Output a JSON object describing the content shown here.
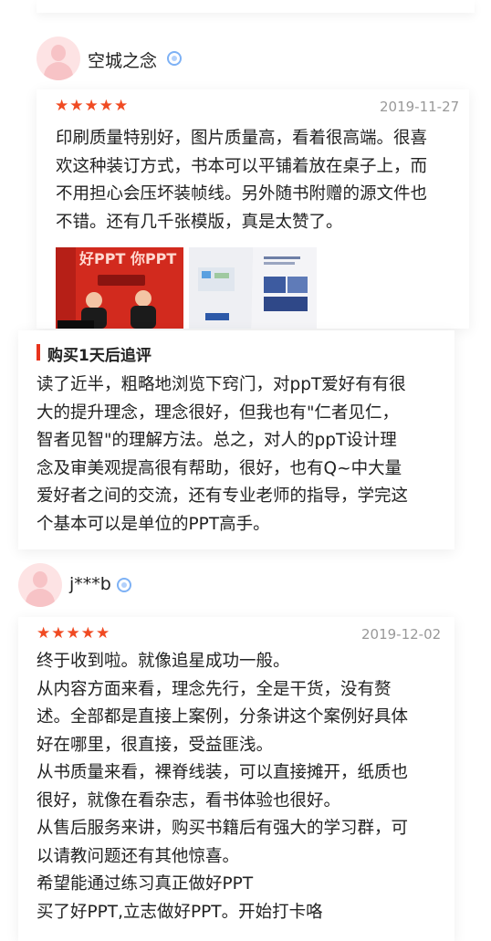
{
  "reviews": [
    {
      "username": "空城之念",
      "rating_text": "★★★★★",
      "rating": 5,
      "date": "2019-11-27",
      "content": [
        "印刷质量特别好，图片质量高，看着很高端。很喜",
        "欢这种装订方式，书本可以平铺着放在桌子上，而",
        "不用担心会压坏装帧线。另外随书附赠的源文件也",
        "不错。还有几千张模版，真是太赞了。"
      ],
      "photos": [
        {
          "label": "book-cover-photo",
          "cover_text": "好PPT 你PPT"
        },
        {
          "label": "book-inner-page-photo"
        }
      ],
      "followup": {
        "title": "购买1天后追评",
        "content": [
          "读了近半，粗略地浏览下窍门，对ppT爱好有有很",
          "大的提升理念，理念很好，但我也有\"仁者见仁，",
          "智者见智\"的理解方法。总之，对人的ppT设计理",
          "念及审美观提高很有帮助，很好，也有Q~中大量",
          "爱好者之间的交流，还有专业老师的指导，学完这",
          "个基本可以是单位的PPT高手。"
        ]
      }
    },
    {
      "username": "j***b",
      "rating_text": "★★★★★",
      "rating": 5,
      "date": "2019-12-02",
      "content": [
        "终于收到啦。就像追星成功一般。",
        "从内容方面来看，理念先行，全是干货，没有赘",
        "述。全部都是直接上案例，分条讲这个案例好具体",
        "好在哪里，很直接，受益匪浅。",
        "从书质量来看，裸脊线装，可以直接摊开，纸质也",
        "很好，就像在看杂志，看书体验也很好。",
        "从售后服务来讲，购买书籍后有强大的学习群，可",
        "以请教问题还有其他惊喜。",
        "希望能通过练习真正做好PPT",
        "买了好PPT,立志做好PPT。开始打卡咯"
      ]
    }
  ],
  "colors": {
    "star": "#f04a22",
    "accent_bar": "#e8331c",
    "badge": "#7db1f5",
    "avatar_bg": "#fde3e4"
  }
}
